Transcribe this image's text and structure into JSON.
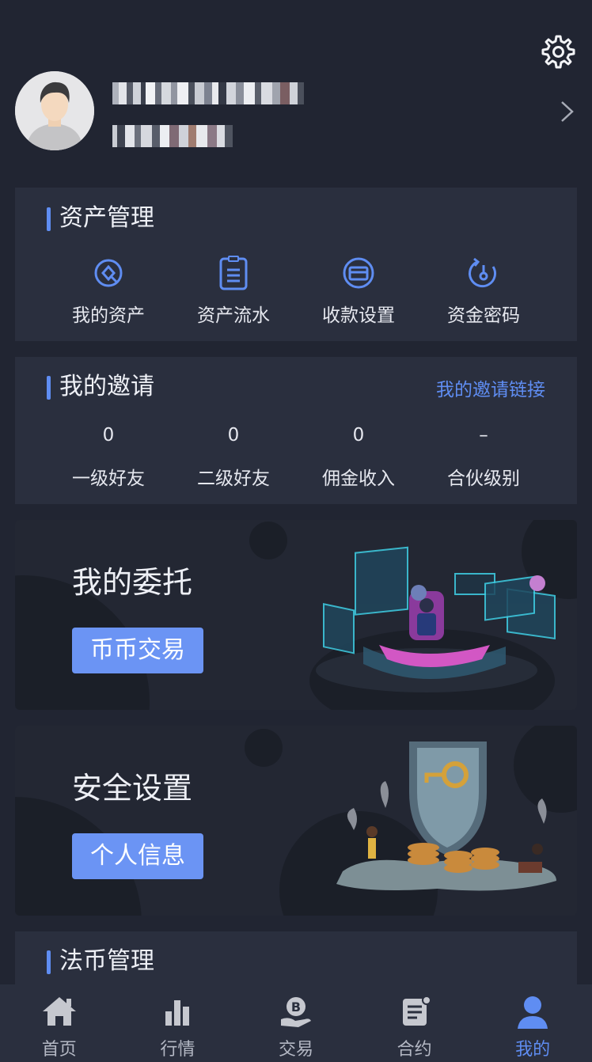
{
  "user": {
    "name_masked": "",
    "id_masked": ""
  },
  "asset_section": {
    "title": "资产管理",
    "items": [
      {
        "label": "我的资产",
        "icon": "wallet-icon"
      },
      {
        "label": "资产流水",
        "icon": "clipboard-icon"
      },
      {
        "label": "收款设置",
        "icon": "card-icon"
      },
      {
        "label": "资金密码",
        "icon": "key-lock-icon"
      }
    ]
  },
  "invite_section": {
    "title": "我的邀请",
    "link_label": "我的邀请链接",
    "stats": [
      {
        "value": "0",
        "label": "一级好友"
      },
      {
        "value": "0",
        "label": "二级好友"
      },
      {
        "value": "0",
        "label": "佣金收入"
      },
      {
        "value": "–",
        "label": "合伙级别"
      }
    ]
  },
  "orders_banner": {
    "title": "我的委托",
    "button": "币币交易"
  },
  "security_banner": {
    "title": "安全设置",
    "button": "个人信息"
  },
  "fiat_section": {
    "title": "法币管理"
  },
  "tabbar": {
    "items": [
      {
        "label": "首页",
        "icon": "home-icon"
      },
      {
        "label": "行情",
        "icon": "bar-chart-icon"
      },
      {
        "label": "交易",
        "icon": "bitcoin-hand-icon"
      },
      {
        "label": "合约",
        "icon": "contract-icon"
      },
      {
        "label": "我的",
        "icon": "user-icon"
      }
    ],
    "active_index": 4
  },
  "colors": {
    "accent": "#5f8df2",
    "background": "#212532",
    "card": "#2a2f3e",
    "button": "#6b94f4"
  }
}
